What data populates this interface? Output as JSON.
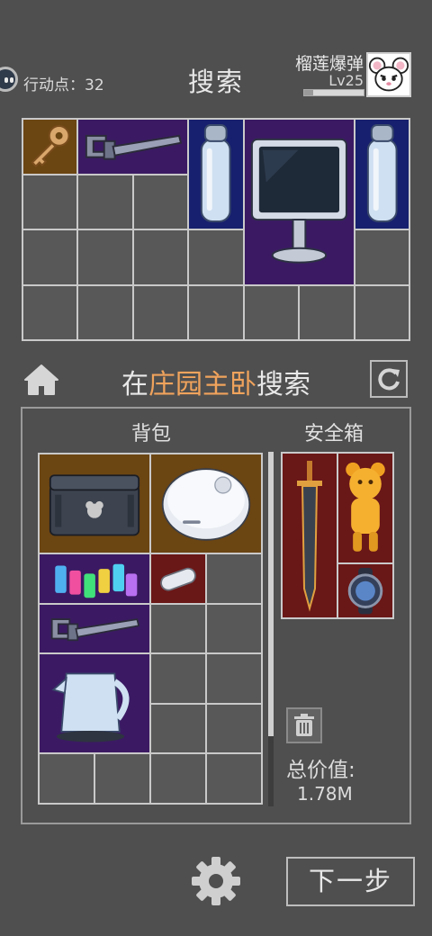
{
  "header": {
    "action_points_label": "行动点：32",
    "title": "搜索",
    "player_name": "榴莲爆弹",
    "level": "Lv25",
    "level_progress": 0.15
  },
  "loot_grid": {
    "items": [
      {
        "name": "key",
        "rarity": "gold"
      },
      {
        "name": "pipe-wrench",
        "rarity": "purple"
      },
      {
        "name": "water-bottle",
        "rarity": "blue"
      },
      {
        "name": "computer-monitor",
        "rarity": "purple"
      },
      {
        "name": "water-bottle",
        "rarity": "blue"
      }
    ]
  },
  "location": {
    "prefix": "在",
    "place": "庄园主卧",
    "suffix": "搜索"
  },
  "inventory": {
    "backpack_label": "背包",
    "safe_box_label": "安全箱",
    "backpack_items": [
      {
        "name": "hard-case",
        "rarity": "gold"
      },
      {
        "name": "robot-vacuum",
        "rarity": "gold"
      },
      {
        "name": "medicine-bottles",
        "rarity": "purple"
      },
      {
        "name": "capsule-pill",
        "rarity": "red"
      },
      {
        "name": "pipe-wrench",
        "rarity": "purple"
      },
      {
        "name": "electric-kettle",
        "rarity": "purple"
      }
    ],
    "safe_items": [
      {
        "name": "sword",
        "rarity": "red"
      },
      {
        "name": "golden-bear-figure",
        "rarity": "red"
      },
      {
        "name": "watch",
        "rarity": "red"
      }
    ],
    "backpack_scroll": 0.0
  },
  "total_value": {
    "label": "总价值:",
    "value": "1.78M"
  },
  "buttons": {
    "next_label": "下一步"
  },
  "icons": [
    "action-points-icon",
    "home-icon",
    "refresh-icon",
    "trash-icon",
    "gear-icon"
  ],
  "colors": {
    "background": "#4f4f4f",
    "highlight": "#f0a35c",
    "gold": "#6b4512",
    "purple": "#3b1a63",
    "blue": "#17206e",
    "red": "#6a1717"
  }
}
